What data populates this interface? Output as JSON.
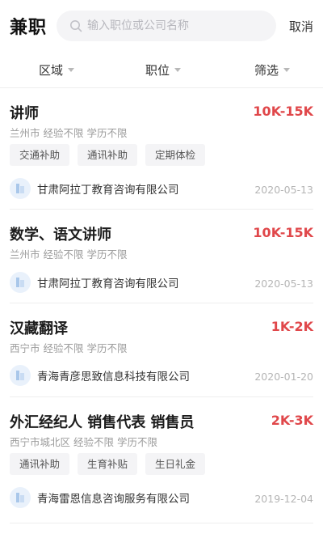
{
  "header": {
    "title": "兼职",
    "search_placeholder": "输入职位或公司名称",
    "cancel_label": "取消"
  },
  "filters": [
    {
      "label": "区域"
    },
    {
      "label": "职位"
    },
    {
      "label": "筛选"
    }
  ],
  "jobs": [
    {
      "title": "讲师",
      "salary": "10K-15K",
      "meta": "兰州市 经验不限 学历不限",
      "tags": [
        "交通补助",
        "通讯补助",
        "定期体检"
      ],
      "company": "甘肃阿拉丁教育咨询有限公司",
      "date": "2020-05-13"
    },
    {
      "title": "数学、语文讲师",
      "salary": "10K-15K",
      "meta": "兰州市 经验不限 学历不限",
      "tags": [],
      "company": "甘肃阿拉丁教育咨询有限公司",
      "date": "2020-05-13"
    },
    {
      "title": "汉藏翻译",
      "salary": "1K-2K",
      "meta": "西宁市 经验不限 学历不限",
      "tags": [],
      "company": "青海青彦思致信息科技有限公司",
      "date": "2020-01-20"
    },
    {
      "title": "外汇经纪人 销售代表 销售员",
      "salary": "2K-3K",
      "meta": "西宁市城北区 经验不限 学历不限",
      "tags": [
        "通讯补助",
        "生育补贴",
        "生日礼金"
      ],
      "company": "青海雷恩信息咨询服务有限公司",
      "date": "2019-12-04"
    }
  ],
  "colors": {
    "salary": "#e0474a",
    "muted": "#9c9c9c",
    "tag_bg": "#f4f4f6"
  }
}
